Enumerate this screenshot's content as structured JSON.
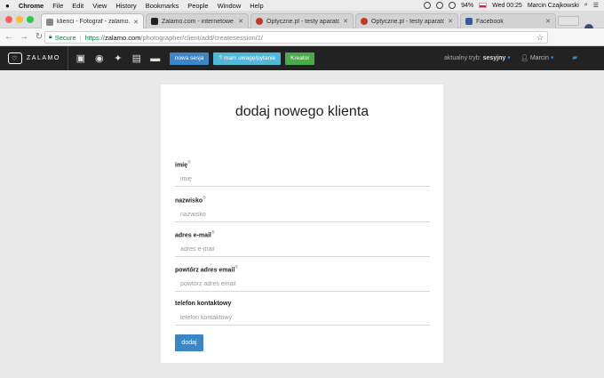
{
  "menubar": {
    "app": "Chrome",
    "items": [
      "File",
      "Edit",
      "View",
      "History",
      "Bookmarks",
      "People",
      "Window",
      "Help"
    ],
    "battery": "94%",
    "datetime": "Wed 00:25",
    "user": "Marcin Czajkowski"
  },
  "tabs": [
    {
      "title": "klienci - Fotograf - zalamo.com",
      "color": "#888888"
    },
    {
      "title": "Zalamo.com - internetowe narzęd",
      "color": "#222222"
    },
    {
      "title": "Optyczne.pl - testy aparatów, o",
      "color": "#c0392b"
    },
    {
      "title": "Optyczne.pl - testy aparatów, o",
      "color": "#c0392b"
    },
    {
      "title": "Facebook",
      "color": "#3b5998"
    }
  ],
  "omnibox": {
    "secure_label": "Secure",
    "scheme": "https://",
    "host": "zalamo.com",
    "path": "/photographer/client/add/createsession/1/"
  },
  "appnav": {
    "logo_text": "ZALAMO",
    "btn_new_session": "nowa sesja",
    "btn_feedback": "mam uwagę/pytanie",
    "btn_creator": "Kreator",
    "mode_label": "aktualny tryb:",
    "mode_value": "sesyjny",
    "user_name": "Marcin"
  },
  "form": {
    "title": "dodaj nowego klienta",
    "fields": [
      {
        "label": "imię",
        "required": true,
        "placeholder": "imię"
      },
      {
        "label": "nazwisko",
        "required": true,
        "placeholder": "nazwisko"
      },
      {
        "label": "adres e-mail",
        "required": true,
        "placeholder": "adres e-mail"
      },
      {
        "label": "powtórz adres email",
        "required": true,
        "placeholder": "powtórz adres email"
      },
      {
        "label": "telefon kontaktowy",
        "required": false,
        "placeholder": "telefon kontaktowy"
      }
    ],
    "required_mark": "®",
    "submit_label": "dodaj"
  },
  "colors": {
    "navbar": "#222222",
    "primary": "#3d86c6",
    "info": "#4fb9d7",
    "success": "#4aa94a",
    "page_bg": "#e9e9e9"
  }
}
